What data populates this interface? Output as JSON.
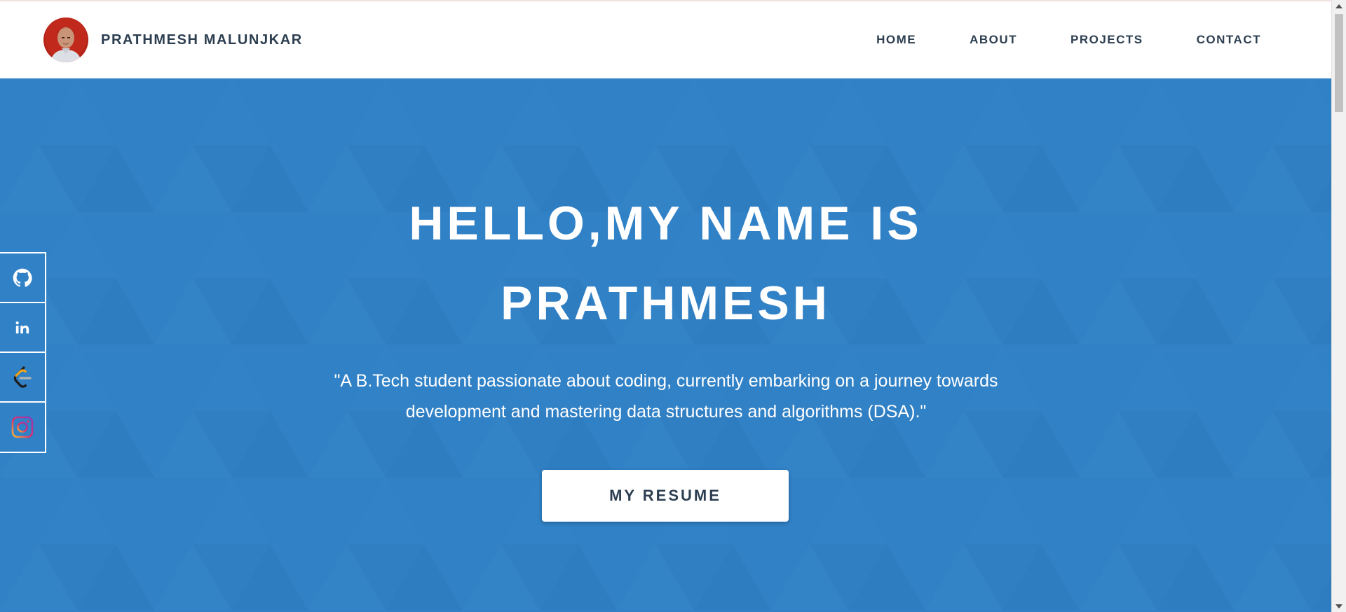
{
  "header": {
    "brand_name": "PRATHMESH MALUNJKAR",
    "nav": [
      {
        "label": "HOME"
      },
      {
        "label": "ABOUT"
      },
      {
        "label": "PROJECTS"
      },
      {
        "label": "CONTACT"
      }
    ]
  },
  "hero": {
    "title_line1": "HELLO,MY NAME IS",
    "title_line2": "PRATHMESH",
    "subtitle": "\"A B.Tech student passionate about coding, currently embarking on a journey towards development and mastering data structures and algorithms (DSA).\"",
    "resume_button": "MY RESUME"
  },
  "social": [
    {
      "icon": "github-icon"
    },
    {
      "icon": "linkedin-icon"
    },
    {
      "icon": "leetcode-icon"
    },
    {
      "icon": "instagram-icon"
    }
  ],
  "colors": {
    "hero_background": "#3181c6",
    "nav_text": "#2c3e50",
    "white": "#ffffff"
  }
}
